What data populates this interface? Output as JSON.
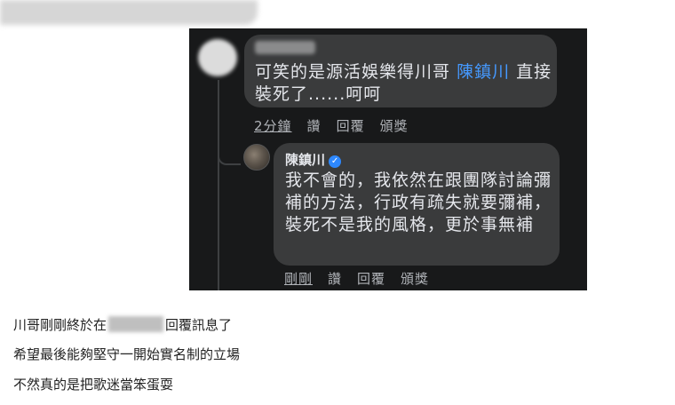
{
  "comment1": {
    "text_before": "可笑的是源活娛樂得川哥",
    "mention": "陳鎮川",
    "text_after": "直接裝死了......呵呵",
    "actions": {
      "time": "2分鐘",
      "like": "讚",
      "reply": "回覆",
      "share": "頒獎"
    }
  },
  "reply1": {
    "author": "陳鎮川",
    "verified_icon": "check-icon",
    "text": "我不會的，我依然在跟團隊討論彌補的方法，行政有疏失就要彌補，裝死不是我的風格，更於事無補",
    "actions": {
      "time": "剛剛",
      "like": "讚",
      "reply": "回覆",
      "share": "頒獎"
    }
  },
  "captions": {
    "line1_before": "川哥剛剛終於在",
    "line1_after": "回覆訊息了",
    "line2": "希望最後能夠堅守一開始實名制的立場",
    "line3": "不然真的是把歌迷當笨蛋耍"
  }
}
